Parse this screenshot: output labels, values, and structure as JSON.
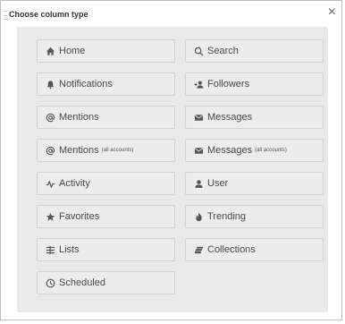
{
  "dialog": {
    "title": "Choose column type",
    "close": "×"
  },
  "buttons": [
    {
      "label": "Home",
      "sub": "",
      "icon": "home-icon"
    },
    {
      "label": "Search",
      "sub": "",
      "icon": "search-icon"
    },
    {
      "label": "Notifications",
      "sub": "",
      "icon": "bell-icon"
    },
    {
      "label": "Followers",
      "sub": "",
      "icon": "add-user-icon"
    },
    {
      "label": "Mentions",
      "sub": "",
      "icon": "at-icon"
    },
    {
      "label": "Messages",
      "sub": "",
      "icon": "envelope-icon"
    },
    {
      "label": "Mentions",
      "sub": "(all accounts)",
      "icon": "at-icon"
    },
    {
      "label": "Messages",
      "sub": "(all accounts)",
      "icon": "envelope-icon"
    },
    {
      "label": "Activity",
      "sub": "",
      "icon": "activity-icon"
    },
    {
      "label": "User",
      "sub": "",
      "icon": "user-icon"
    },
    {
      "label": "Favorites",
      "sub": "",
      "icon": "star-icon"
    },
    {
      "label": "Trending",
      "sub": "",
      "icon": "fire-icon"
    },
    {
      "label": "Lists",
      "sub": "",
      "icon": "list-icon"
    },
    {
      "label": "Collections",
      "sub": "",
      "icon": "collections-icon"
    },
    {
      "label": "Scheduled",
      "sub": "",
      "icon": "clock-icon"
    }
  ]
}
